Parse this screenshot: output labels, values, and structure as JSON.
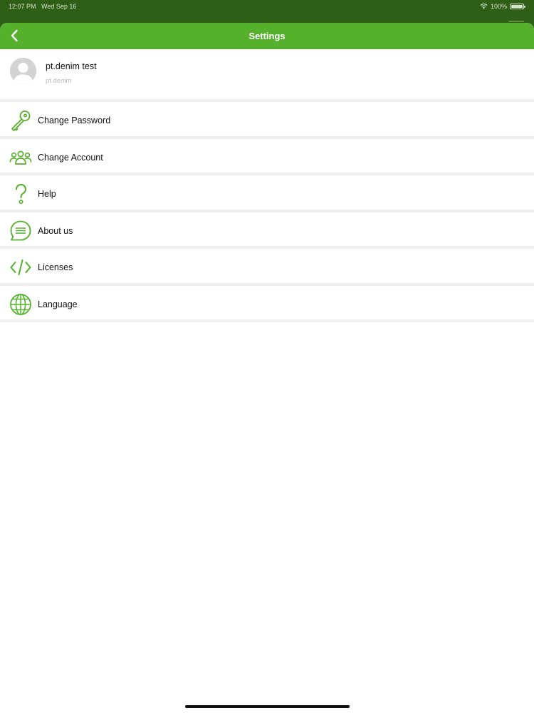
{
  "status_bar": {
    "time": "12:07 PM",
    "date": "Wed Sep 16",
    "battery": "100%"
  },
  "header": {
    "title": "Settings"
  },
  "profile": {
    "name": "pt.denim test",
    "username": "pt.denim"
  },
  "menu": {
    "items": [
      {
        "label": "Change Password",
        "icon": "key-icon"
      },
      {
        "label": "Change Account",
        "icon": "people-icon"
      },
      {
        "label": "Help",
        "icon": "question-icon"
      },
      {
        "label": "About us",
        "icon": "chat-bubble-icon"
      },
      {
        "label": "Licenses",
        "icon": "code-icon"
      },
      {
        "label": "Language",
        "icon": "globe-icon"
      }
    ]
  },
  "colors": {
    "accent": "#55B02B",
    "status_bar_bg": "#2F5F16",
    "separator": "#EEEEEE"
  }
}
